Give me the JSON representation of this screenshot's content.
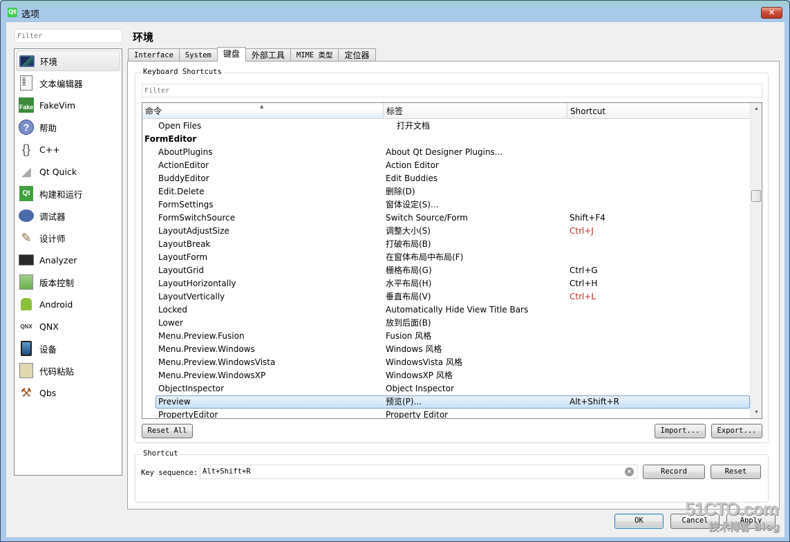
{
  "window": {
    "title": "选项",
    "app_icon": "qt-logo-icon",
    "close_label": "✕"
  },
  "sidebar": {
    "filter_placeholder": "Filter",
    "items": [
      {
        "label": "环境",
        "icon": "environment-icon",
        "selected": true
      },
      {
        "label": "文本编辑器",
        "icon": "text-editor-icon"
      },
      {
        "label": "FakeVim",
        "icon": "fakevim-icon"
      },
      {
        "label": "帮助",
        "icon": "help-icon"
      },
      {
        "label": "C++",
        "icon": "cpp-braces-icon"
      },
      {
        "label": "Qt Quick",
        "icon": "qt-quick-icon"
      },
      {
        "label": "构建和运行",
        "icon": "build-run-icon"
      },
      {
        "label": "调试器",
        "icon": "debugger-icon"
      },
      {
        "label": "设计师",
        "icon": "designer-icon"
      },
      {
        "label": "Analyzer",
        "icon": "analyzer-icon"
      },
      {
        "label": "版本控制",
        "icon": "version-control-icon"
      },
      {
        "label": "Android",
        "icon": "android-icon"
      },
      {
        "label": "QNX",
        "icon": "qnx-icon"
      },
      {
        "label": "设备",
        "icon": "devices-icon"
      },
      {
        "label": "代码粘贴",
        "icon": "code-paste-icon"
      },
      {
        "label": "Qbs",
        "icon": "qbs-hammer-icon"
      }
    ]
  },
  "page": {
    "title": "环境",
    "tabs": [
      {
        "label": "Interface"
      },
      {
        "label": "System"
      },
      {
        "label": "键盘",
        "active": true
      },
      {
        "label": "外部工具"
      },
      {
        "label": "MIME 类型"
      },
      {
        "label": "定位器"
      }
    ]
  },
  "shortcuts": {
    "group_title": "Keyboard Shortcuts",
    "filter_placeholder": "Filter",
    "columns": [
      "命令",
      "标签",
      "Shortcut"
    ],
    "sort_indicator": "▲",
    "rows": [
      {
        "command": "Open Files",
        "label": "打开文档",
        "shortcut": "",
        "label_indent": true
      },
      {
        "command": "FormEditor",
        "label": "",
        "shortcut": "",
        "category": true
      },
      {
        "command": "AboutPlugins",
        "label": "About Qt Designer Plugins...",
        "shortcut": ""
      },
      {
        "command": "ActionEditor",
        "label": "Action Editor",
        "shortcut": ""
      },
      {
        "command": "BuddyEditor",
        "label": "Edit Buddies",
        "shortcut": ""
      },
      {
        "command": "Edit.Delete",
        "label": "删除(D)",
        "shortcut": ""
      },
      {
        "command": "FormSettings",
        "label": "窗体设定(S)...",
        "shortcut": ""
      },
      {
        "command": "FormSwitchSource",
        "label": "Switch Source/Form",
        "shortcut": "Shift+F4"
      },
      {
        "command": "LayoutAdjustSize",
        "label": "调整大小(S)",
        "shortcut": "Ctrl+J",
        "conflict": true
      },
      {
        "command": "LayoutBreak",
        "label": "打破布局(B)",
        "shortcut": ""
      },
      {
        "command": "LayoutForm",
        "label": "在窗体布局中布局(F)",
        "shortcut": ""
      },
      {
        "command": "LayoutGrid",
        "label": "栅格布局(G)",
        "shortcut": "Ctrl+G"
      },
      {
        "command": "LayoutHorizontally",
        "label": "水平布局(H)",
        "shortcut": "Ctrl+H"
      },
      {
        "command": "LayoutVertically",
        "label": "垂直布局(V)",
        "shortcut": "Ctrl+L",
        "conflict": true
      },
      {
        "command": "Locked",
        "label": "Automatically Hide View Title Bars",
        "shortcut": ""
      },
      {
        "command": "Lower",
        "label": "放到后面(B)",
        "shortcut": ""
      },
      {
        "command": "Menu.Preview.Fusion",
        "label": "Fusion 风格",
        "shortcut": ""
      },
      {
        "command": "Menu.Preview.Windows",
        "label": "Windows 风格",
        "shortcut": ""
      },
      {
        "command": "Menu.Preview.WindowsVista",
        "label": "WindowsVista 风格",
        "shortcut": ""
      },
      {
        "command": "Menu.Preview.WindowsXP",
        "label": "WindowsXP 风格",
        "shortcut": ""
      },
      {
        "command": "ObjectInspector",
        "label": "Object Inspector",
        "shortcut": ""
      },
      {
        "command": "Preview",
        "label": "预览(P)...",
        "shortcut": "Alt+Shift+R",
        "selected": true
      },
      {
        "command": "PropertyEditor",
        "label": "Property Editor",
        "shortcut": ""
      }
    ],
    "reset_all_label": "Reset All",
    "import_label": "Import...",
    "export_label": "Export..."
  },
  "shortcut_editor": {
    "group_title": "Shortcut",
    "key_sequence_label": "Key sequence:",
    "key_sequence_value": "Alt+Shift+R",
    "record_label": "Record",
    "reset_label": "Reset"
  },
  "dialog_buttons": {
    "ok": "OK",
    "cancel": "Cancel",
    "apply": "Apply"
  },
  "watermark": {
    "line1": "51CTO.com",
    "line2": "技术博客 Blog"
  },
  "colors": {
    "conflict": "#c0302a",
    "selection": "#c8e1f7",
    "title_bar": "#a9c9ea"
  }
}
